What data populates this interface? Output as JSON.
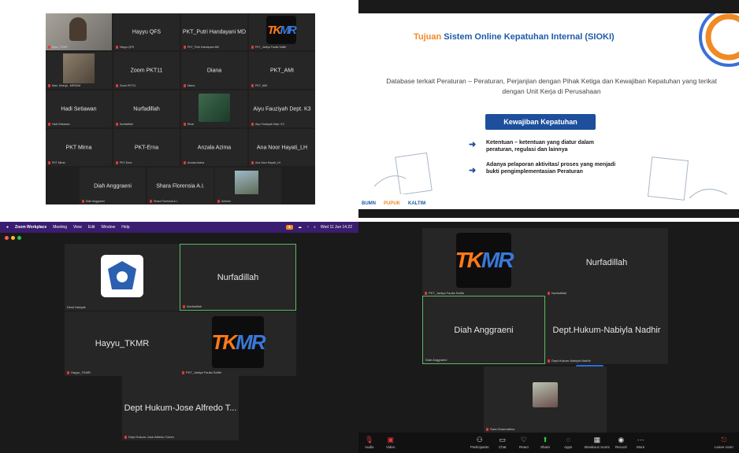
{
  "q1": {
    "tiles": [
      {
        "name": "",
        "label": "Bayu_TKMR"
      },
      {
        "name": "Hayyu QFS",
        "label": "Hayyu QFS"
      },
      {
        "name": "PKT_Putri Handayani MD",
        "label": "PKT_Putri Handayani MD"
      },
      {
        "name": "",
        "label": "PKT_Jadiya Faulia Safitri"
      },
      {
        "name": "",
        "label": "Man. Kinerja - MRSDM"
      },
      {
        "name": "Zoom PKT11",
        "label": "Zoom PKT11"
      },
      {
        "name": "Diana",
        "label": "Diana"
      },
      {
        "name": "PKT_AMI",
        "label": "PKT_AMI"
      },
      {
        "name": "Hadi Setiawan",
        "label": "Hadi Setiawan"
      },
      {
        "name": "Nurfadillah",
        "label": "Nurfadillah"
      },
      {
        "name": "",
        "label": "Rizal"
      },
      {
        "name": "Aiyu Fauziyah Dept. K3",
        "label": "Aiyu Fauziyah Dept. K3"
      },
      {
        "name": "PKT Mirna",
        "label": "PKT Mirna"
      },
      {
        "name": "PKT-Erna",
        "label": "PKT-Erna"
      },
      {
        "name": "Anzala Azima",
        "label": "Anzala Azima"
      },
      {
        "name": "Ana Noor Hayati_LH",
        "label": "Ana Noor Hayati_LH"
      },
      {
        "name": "Diah Anggraeni",
        "label": "Diah Anggraeni"
      },
      {
        "name": "Shara Florensia A.I.",
        "label": "Shara Florensia A.I."
      },
      {
        "name": "",
        "label": "Antonio"
      }
    ],
    "logo_text_a": "TK",
    "logo_text_b": "MR"
  },
  "q2": {
    "title_a": "Tujuan",
    "title_b": "Sistem Online Kepatuhan Internal (SIOKI)",
    "desc": "Database terkait Peraturan – Peraturan, Perjanjian dengan Pihak Ketiga dan Kewajiban Kepatuhan yang terikat dengan Unit Kerja di Perusahaan",
    "button": "Kewajiban Kepatuhan",
    "bullets": [
      "Ketentuan – ketentuan yang diatur dalam peraturan, regulasi dan lainnya",
      "Adanya pelaporan aktivitas/ proses yang menjadi bukti pengimplementasian Peraturan"
    ],
    "footer": [
      "BUMN",
      "PUPUK",
      "KALTIM"
    ]
  },
  "q3": {
    "menubar": [
      "Zoom Workplace",
      "Meeting",
      "View",
      "Edit",
      "Window",
      "Help"
    ],
    "clock": "Wed 11 Jun 14.22",
    "tiles": [
      {
        "name": "",
        "label": "Dewi Hariyati"
      },
      {
        "name": "Nurfadillah",
        "label": "Nurfadillah"
      },
      {
        "name": "Hayyu_TKMR",
        "label": "Hayyu_TKMR"
      },
      {
        "name": "",
        "label": "PKT_Jadiya Faulia Safitri"
      },
      {
        "name": "Dept Hukum-Jose Alfredo T...",
        "label": "Dept Hukum-Jose Alfredo Torres"
      }
    ]
  },
  "q4": {
    "tiles": [
      {
        "name": "",
        "label": "PKT_Jadiya Faulia Safitri"
      },
      {
        "name": "Nurfadillah",
        "label": "Nurfadillah"
      },
      {
        "name": "Diah Anggraeni",
        "label": "Diah Anggraeni"
      },
      {
        "name": "Dept.Hukum-Nabiyla Nadhir",
        "label": "Dept.Hukum-Nabiyla Nadhir"
      },
      {
        "name": "",
        "label": "Sara Dharmathus"
      }
    ],
    "pill": "Ask to unmute",
    "toolbar": [
      "Audio",
      "Video",
      "Participants",
      "Chat",
      "React",
      "Share",
      "Apps",
      "Breakout rooms",
      "Record",
      "More",
      "Leave room"
    ]
  },
  "colors": {
    "accent_orange": "#f08a24",
    "accent_blue": "#1e5aa8",
    "speaker_green": "#5fb85f"
  }
}
